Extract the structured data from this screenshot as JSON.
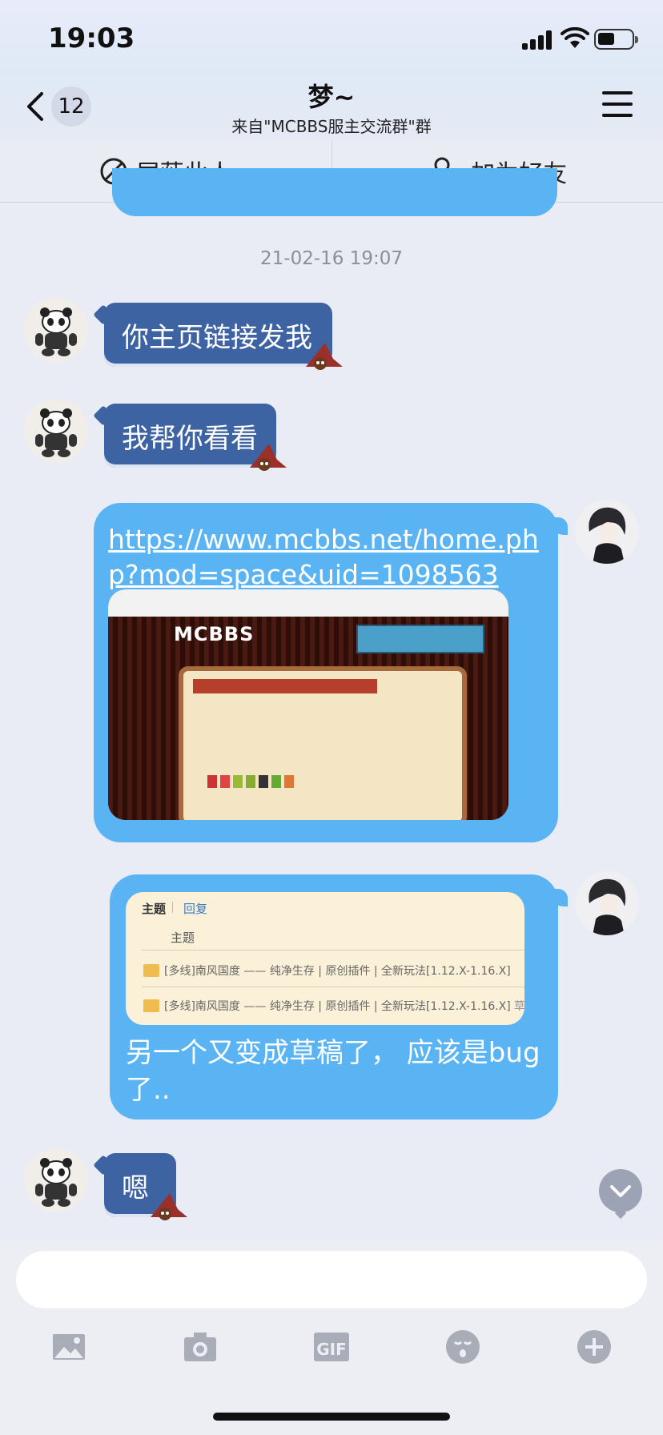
{
  "status_bar": {
    "time": "19:03"
  },
  "header": {
    "back_count": "12",
    "title": "梦~",
    "subtitle": "来自\"MCBBS服主交流群\"群"
  },
  "actions": {
    "block_label": "屏蔽此人",
    "add_friend_label": "加为好友"
  },
  "timestamp": "21-02-16 19:07",
  "messages": {
    "m1": "你主页链接发我",
    "m2": "我帮你看看",
    "m3_link": "https://www.mcbbs.net/home.php?mod=space&uid=1098563",
    "m3_logo": "MCBBS",
    "m4_card": {
      "tab_topic": "主题",
      "tab_reply": "回复",
      "column_label": "主题",
      "row1": "[多线]南风国度 —— 纯净生存 | 原创插件 | 全新玩法[1.12.X-1.16.X]",
      "row2": "[多线]南风国度 —— 纯净生存 | 原创插件 | 全新玩法[1.12.X-1.16.X]",
      "row2_suffix": "草稿"
    },
    "m4_text": "另一个又变成草稿了， 应该是bug了..",
    "m5": "嗯"
  },
  "composer": {
    "placeholder": ""
  },
  "icons": [
    "back-chevron-icon",
    "menu-icon",
    "block-icon",
    "add-friend-icon",
    "image-icon",
    "camera-icon",
    "gif-icon",
    "emoji-icon",
    "plus-icon",
    "scroll-down-icon"
  ],
  "colors": {
    "incoming_bubble": "#3d63a2",
    "outgoing_bubble": "#5ab4f4",
    "background": "#e9ebf5"
  }
}
